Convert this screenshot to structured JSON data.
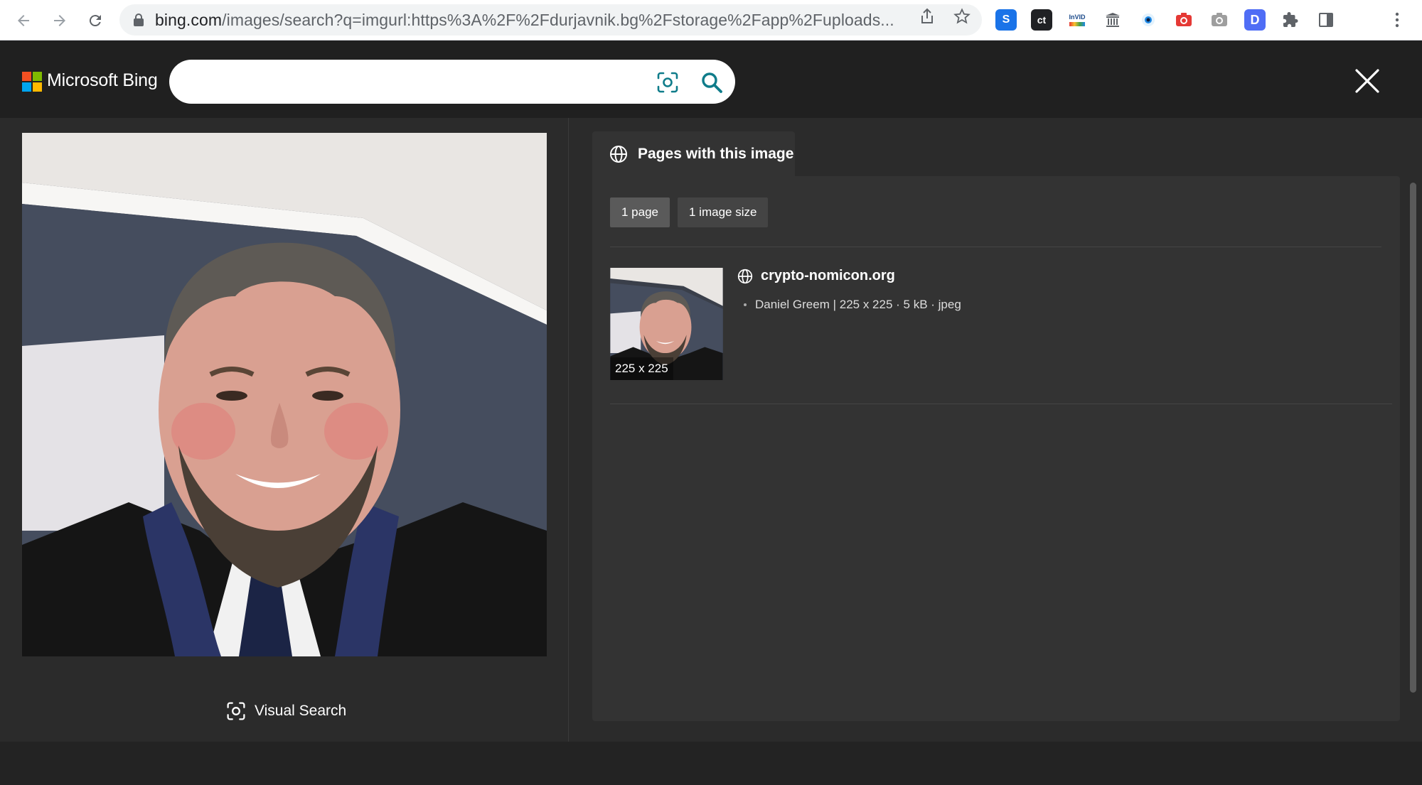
{
  "browser": {
    "url_host": "bing.com",
    "url_rest": "/images/search?q=imgurl:https%3A%2F%2Fdurjavnik.bg%2Fstorage%2Fapp%2Fuploads...",
    "extensions": [
      {
        "name": "s-extension-icon",
        "label": "S",
        "color": "#1a73e8"
      },
      {
        "name": "ct-extension-icon",
        "label": "ct",
        "color": "#202124"
      },
      {
        "name": "invid-extension-icon",
        "label": "InVID",
        "color": "#ffffff"
      },
      {
        "name": "archive-extension-icon",
        "label": "",
        "color": "#ffffff"
      },
      {
        "name": "eye-extension-icon",
        "label": "",
        "color": "#ffffff"
      },
      {
        "name": "camera-red-extension-icon",
        "label": "",
        "color": "#e53935"
      },
      {
        "name": "camera-grey-extension-icon",
        "label": "",
        "color": "#9e9e9e"
      },
      {
        "name": "d-extension-icon",
        "label": "D",
        "color": "#4f6df5"
      }
    ]
  },
  "bing": {
    "brand": "Microsoft Bing",
    "search_value": "",
    "logo_colors": [
      "#f25022",
      "#7fba00",
      "#00a4ef",
      "#ffb900"
    ],
    "accent": "#0f7c8a"
  },
  "left": {
    "visual_search_label": "Visual Search"
  },
  "right": {
    "tab_label": "Pages with this image",
    "chips": [
      "1 page",
      "1 image size"
    ],
    "result": {
      "site": "crypto-nomicon.org",
      "meta": "Daniel Greem | 225 x 225 · 5 kB · jpeg",
      "thumb_size": "225 x 225"
    }
  }
}
